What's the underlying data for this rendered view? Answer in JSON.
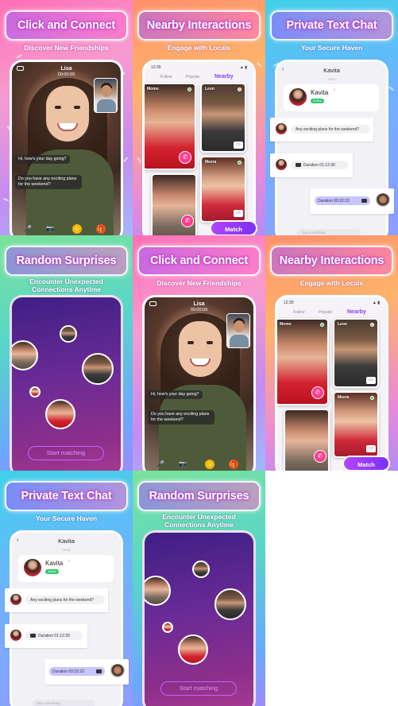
{
  "tiles": {
    "click_connect": {
      "banner": "Click and Connect",
      "subtitle": "Discover New Friendships",
      "caller_name": "Lisa",
      "call_time": "00:00:09",
      "bubble_1": "Hi, how's your day going?",
      "bubble_2": "Do you have any exciting plans for the weekend?"
    },
    "nearby": {
      "banner": "Nearby Interactions",
      "subtitle": "Engage with Locals",
      "status_time": "12:30",
      "tabs": [
        "Follow",
        "Popular",
        "Nearby"
      ],
      "cards": [
        "Momo",
        "Leon",
        "Meera"
      ],
      "match_label": "Match"
    },
    "private_chat": {
      "banner": "Private Text Chat",
      "subtitle": "Your Secure Haven",
      "chat_title": "Kavita",
      "chat_date": "20:00",
      "profile_name": "Kavita",
      "age_badge": "Active",
      "msg_question": "Any exciting plans for the weekend?",
      "msg_duration_in": "Duration 01:12:30",
      "msg_duration_out": "Duration 00:22:23",
      "input_placeholder": "Say something"
    },
    "random": {
      "banner": "Random Surprises",
      "subtitle_line1": "Encounter Unexpected",
      "subtitle_line2": "Connections Anytime",
      "start_label": "Start matching"
    }
  },
  "colors": {
    "accent": "#8a3dff",
    "pink": "#ff3c8e",
    "online": "#3ed26a"
  },
  "icons": [
    "mic-icon",
    "camera-icon",
    "emoji-icon",
    "gift-icon",
    "phone-icon",
    "chat-icon",
    "video-icon",
    "back-icon",
    "send-icon"
  ]
}
